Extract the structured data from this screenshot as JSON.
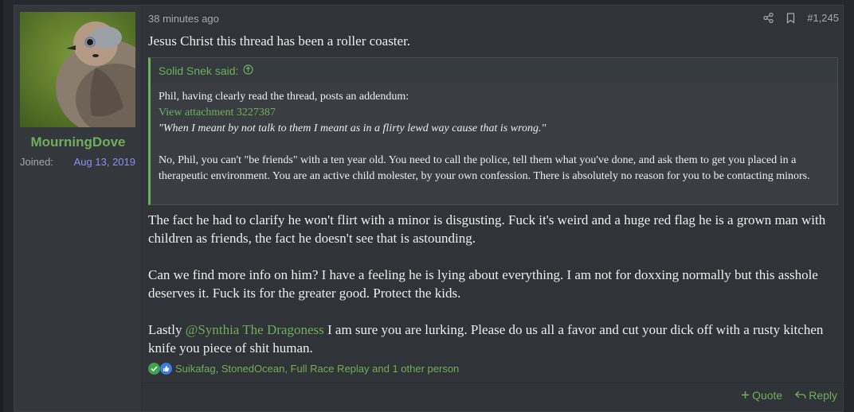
{
  "user": {
    "username": "MourningDove",
    "joined_label": "Joined:",
    "joined_date": "Aug 13, 2019"
  },
  "post": {
    "time": "38 minutes ago",
    "number": "#1,245",
    "first_line": "Jesus Christ this thread has been a roller coaster.",
    "quote": {
      "author_line": "Solid Snek said:",
      "line1": "Phil, having clearly read the thread, posts an addendum:",
      "attachment": "View attachment 3227387",
      "italic": "\"When I meant by not talk to them I meant as in a flirty lewd way cause that is wrong.\"",
      "para2": "No, Phil, you can't \"be friends\" with a ten year old. You need to call the police, tell them what you've done, and ask them to get you placed in a therapeutic environment. You are an active child molester, by your own confession. There is absolutely no reason for you to be contacting minors."
    },
    "para1": "The fact he had to clarify he won't flirt with a minor is disgusting. Fuck it's weird and a huge red flag he is a grown man with children as friends, the fact he doesn't see that is astounding.",
    "para2": "Can we find more info on him? I have a feeling he is lying about everything. I am not for doxxing normally but this asshole deserves it. Fuck its for the greater good. Protect the kids.",
    "para3_prefix": "Lastly ",
    "para3_mention": "@Synthia The Dragoness",
    "para3_suffix": " I am sure you are lurking. Please do us all a favor and cut your dick off with a rusty kitchen knife you piece of shit human.",
    "reactions_text": "Suikafag, StonedOcean, Full Race Replay and 1 other person",
    "quote_label": "Quote",
    "reply_label": "Reply"
  },
  "icons": [
    "share-icon",
    "bookmark-icon",
    "arrow-up-circle-icon",
    "check-reaction-icon",
    "thumbs-up-reaction-icon",
    "plus-icon",
    "reply-icon"
  ],
  "colors": {
    "accent": "#6fae5a",
    "date": "#8a8ff0",
    "background": "#303337"
  }
}
